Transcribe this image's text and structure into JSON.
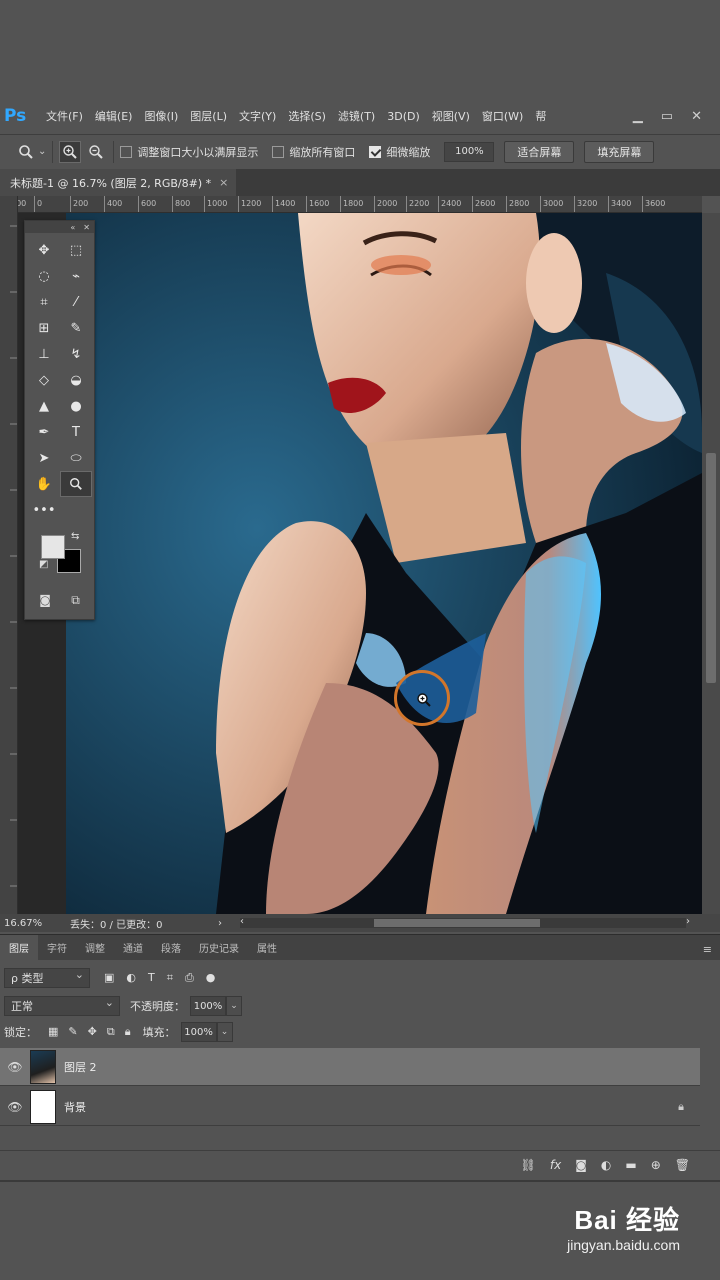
{
  "app": {
    "logo": "Ps",
    "menu": [
      "文件(F)",
      "编辑(E)",
      "图像(I)",
      "图层(L)",
      "文字(Y)",
      "选择(S)",
      "滤镜(T)",
      "3D(D)",
      "视图(V)",
      "窗口(W)",
      "帮"
    ],
    "window_controls": [
      "minimize",
      "restore",
      "close"
    ]
  },
  "options": {
    "fit_window_label": "调整窗口大小以满屏显示",
    "zoom_all_label": "缩放所有窗口",
    "scrubby_label": "细微缩放",
    "zoom_value": "100%",
    "fit_screen_button": "适合屏幕",
    "fill_screen_button": "填充屏幕",
    "fit_window_checked": false,
    "zoom_all_checked": false,
    "scrubby_checked": true
  },
  "document": {
    "tab_title": "未标题-1 @ 16.7% (图层 2, RGB/8#) *",
    "close_glyph": "×"
  },
  "ruler": {
    "h_ticks": [
      "200",
      "0",
      "200",
      "400",
      "600",
      "800",
      "1000",
      "1200",
      "1400",
      "1600",
      "1800",
      "2000",
      "2200",
      "2400",
      "2600",
      "2800",
      "3000",
      "3200",
      "3400",
      "3600"
    ]
  },
  "status": {
    "zoom": "16.67%",
    "info": "丢失：0 / 已更改：0",
    "arrow": "›",
    "scroll_left": "‹",
    "scroll_right": "›"
  },
  "layers_panel": {
    "tabs": [
      "图层",
      "字符",
      "调整",
      "通道",
      "段落",
      "历史记录",
      "属性"
    ],
    "active_tab": 0,
    "filter_label": "ρ 类型",
    "blend_mode": "正常",
    "opacity_label": "不透明度：",
    "opacity_value": "100%",
    "lock_label": "锁定：",
    "fill_label": "填充：",
    "fill_value": "100%",
    "layers": [
      {
        "name": "图层 2",
        "selected": true,
        "visible": true,
        "thumb": "photo",
        "locked": false
      },
      {
        "name": "背景",
        "selected": false,
        "visible": true,
        "thumb": "white",
        "locked": true
      }
    ]
  },
  "watermark": {
    "main": "Bai 经验",
    "sub": "jingyan.baidu.com"
  },
  "colors": {
    "ps_blue": "#31a8ff",
    "zoom_cursor": "#d2762b",
    "selected_layer": "#737373"
  }
}
